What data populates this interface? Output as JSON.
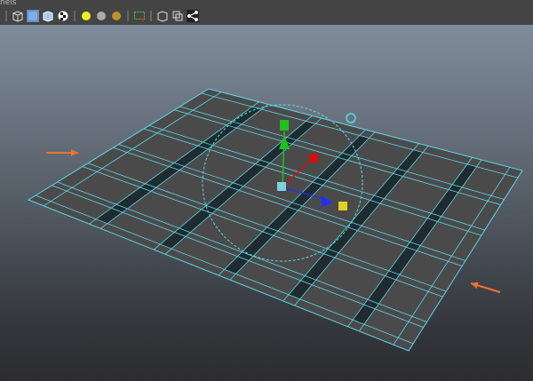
{
  "menu": {
    "panels_label": "nels"
  },
  "toolbar": {
    "icons": [
      "wireframe-cube-icon",
      "smooth-shade-cube-icon",
      "wireframe-on-shaded-icon",
      "texture-checker-icon",
      "default-light-icon",
      "all-lights-icon",
      "shadows-icon",
      "select-region-icon",
      "isolate-select-icon",
      "xray-icon",
      "share-icon"
    ]
  },
  "colors": {
    "wire": "#5fd6e8",
    "face": "#4a4a4a",
    "arrow": "#f07030",
    "x_axis": "#2030ff",
    "y_axis": "#20c020",
    "z_axis": "#d01010",
    "handle": "#e0d020"
  }
}
